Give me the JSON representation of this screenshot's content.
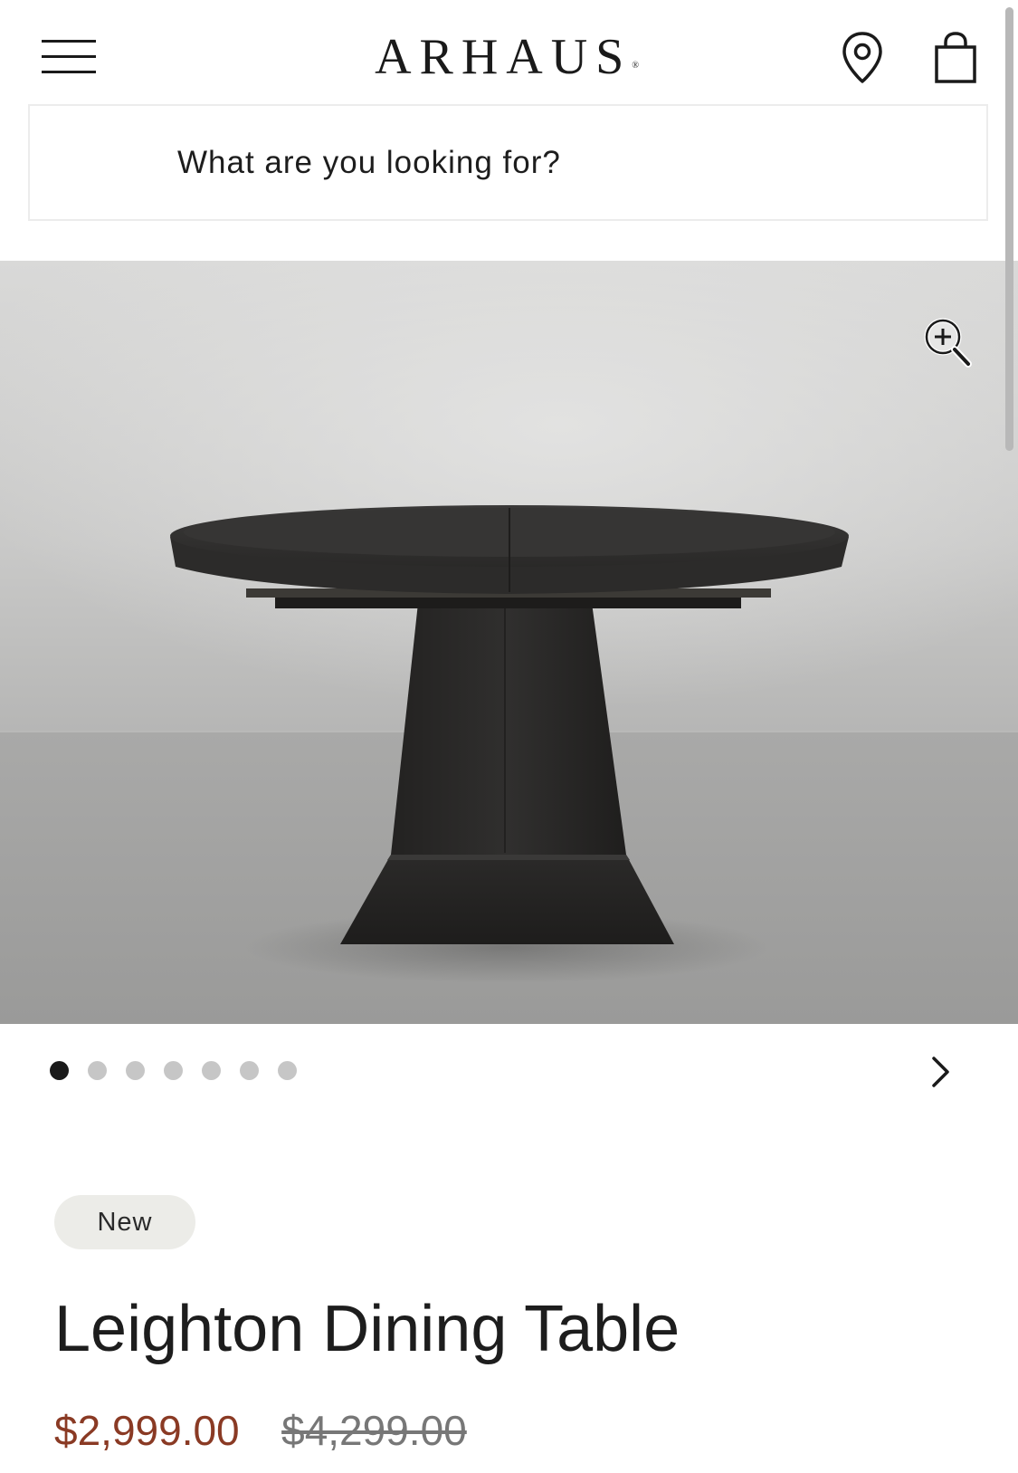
{
  "header": {
    "brand": "ARHAUS",
    "brand_mark": "®"
  },
  "search": {
    "placeholder": "What are you looking for?"
  },
  "carousel": {
    "total_slides": 7,
    "active_index": 0
  },
  "product": {
    "badge": "New",
    "name": "Leighton Dining Table",
    "sale_price": "$2,999.00",
    "original_price": "$4,299.00"
  },
  "colors": {
    "sale_price": "#8a3a24",
    "badge_bg": "#ecece8",
    "active_dot": "#1a1a1a",
    "inactive_dot": "#c6c6c6"
  },
  "icons": {
    "menu": "hamburger-menu-icon",
    "store_locator": "map-pin-icon",
    "cart": "shopping-bag-icon",
    "zoom": "zoom-in-icon",
    "next": "chevron-right-icon"
  }
}
